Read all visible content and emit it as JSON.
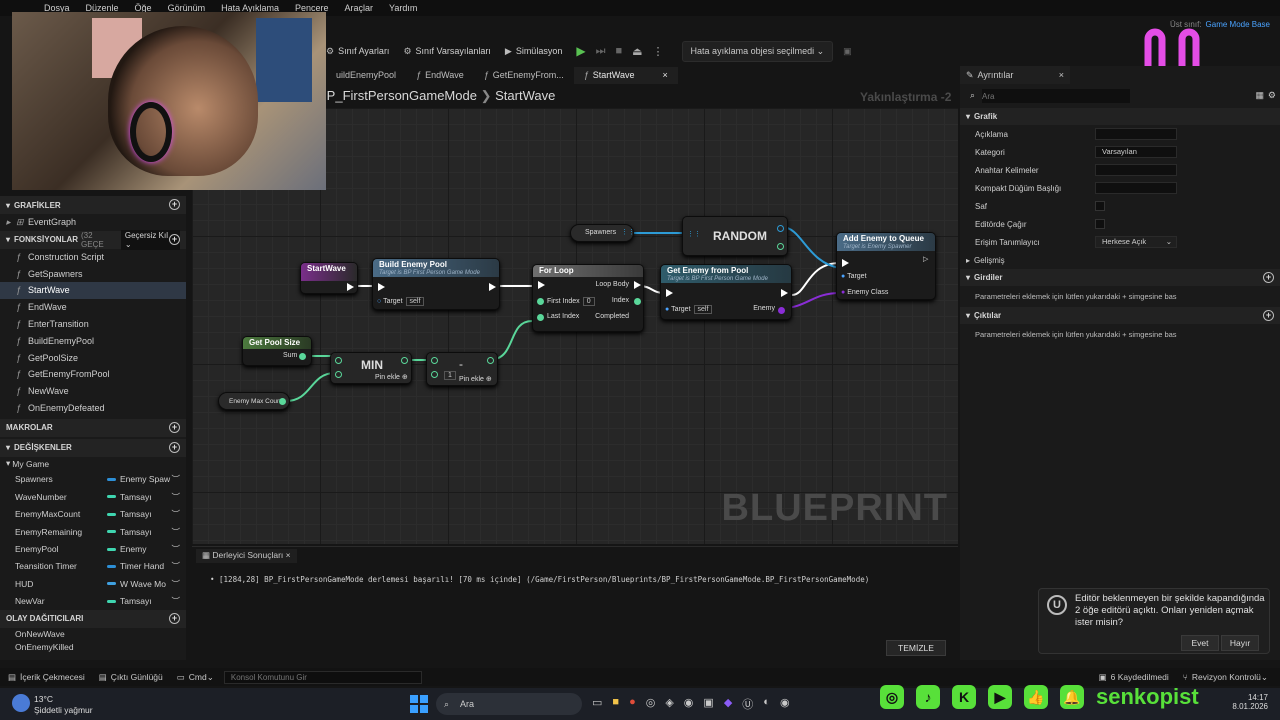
{
  "menu": [
    "Dosya",
    "Düzenle",
    "Öğe",
    "Görünüm",
    "Hata Ayıklama",
    "Pencere",
    "Araçlar",
    "Yardım"
  ],
  "parent_class": {
    "label": "Üst sınıf:",
    "value": "Game Mode Base"
  },
  "toolbar": {
    "class_settings": "Sınıf Ayarları",
    "class_defaults": "Sınıf Varsayılanları",
    "simulation": "Simülasyon",
    "debug_dropdown": "Hata ayıklama objesi seçilmedi"
  },
  "tabs": [
    {
      "label": "uildEnemyPool"
    },
    {
      "label": "EndWave"
    },
    {
      "label": "GetEnemyFrom..."
    },
    {
      "label": "StartWave",
      "active": true
    }
  ],
  "breadcrumb": {
    "graph": "BP_FirstPersonGameMode",
    "function": "StartWave"
  },
  "zoom": "Yakınlaştırma -2",
  "watermark": "BLUEPRINT",
  "nodes": {
    "startwave": "StartWave",
    "build": {
      "title": "Build Enemy Pool",
      "sub": "Target is BP First Person Game Mode",
      "target": "Target",
      "self": "self"
    },
    "forloop": {
      "title": "For Loop",
      "loop_body": "Loop Body",
      "first_index": "First Index",
      "first_val": "0",
      "index": "Index",
      "last_index": "Last Index",
      "completed": "Completed"
    },
    "getenemy": {
      "title": "Get Enemy from Pool",
      "sub": "Target is BP First Person Game Mode",
      "target": "Target",
      "self": "self",
      "enemy": "Enemy"
    },
    "spawners": "Spawners",
    "random": "RANDOM",
    "addqueue": {
      "title": "Add Enemy to Queue",
      "sub": "Target is Enemy Spawner",
      "target": "Target",
      "enemy_class": "Enemy Class"
    },
    "poolsize": {
      "title": "Get Pool Size",
      "sum": "Sum"
    },
    "min": {
      "title": "MIN",
      "add_pin": "Pin ekle"
    },
    "minus": {
      "title": "-",
      "val": "1",
      "add_pin": "Pin ekle"
    },
    "maxcount": "Enemy Max Count"
  },
  "left": {
    "graphs_header": "GRAFİKLER",
    "event_graph": "EventGraph",
    "functions_header": "FONKSİYONLAR",
    "functions_count": "(32 GEÇE",
    "override_dropdown": "Geçersiz Kıl",
    "functions": [
      "Construction Script",
      "GetSpawners",
      "StartWave",
      "EndWave",
      "EnterTransition",
      "BuildEnemyPool",
      "GetPoolSize",
      "GetEnemyFromPool",
      "NewWave",
      "OnEnemyDefeated"
    ],
    "macros_header": "MAKROLAR",
    "variables_header": "DEĞİŞKENLER",
    "my_game": "My Game",
    "variables": [
      {
        "name": "Spawners",
        "type": "Enemy Spaw",
        "color": "#2d8fd6"
      },
      {
        "name": "WaveNumber",
        "type": "Tamsayı",
        "color": "#3fd6b0"
      },
      {
        "name": "EnemyMaxCount",
        "type": "Tamsayı",
        "color": "#3fd6b0"
      },
      {
        "name": "EnemyRemaining",
        "type": "Tamsayı",
        "color": "#3fd6b0"
      },
      {
        "name": "EnemyPool",
        "type": "Enemy",
        "color": "#3fd6b0"
      },
      {
        "name": "Teansition Timer",
        "type": "Timer Hand",
        "color": "#2d8fd6"
      },
      {
        "name": "HUD",
        "type": "W Wave Mo",
        "color": "#3fa0e0"
      },
      {
        "name": "NewVar",
        "type": "Tamsayı",
        "color": "#3fd6b0"
      }
    ],
    "dispatchers_header": "OLAY DAĞITICILARI",
    "dispatchers": [
      "OnNewWave",
      "OnEnemyKilled"
    ]
  },
  "details": {
    "tab": "Ayrıntılar",
    "search_placeholder": "Ara",
    "graphic_header": "Grafik",
    "rows": {
      "description": "Açıklama",
      "category": "Kategori",
      "category_value": "Varsayılan",
      "keywords": "Anahtar Kelimeler",
      "compact_title": "Kompakt Düğüm Başlığı",
      "pure": "Saf",
      "call_in_editor": "Editörde Çağır",
      "access": "Erişim Tanımlayıcı",
      "access_value": "Herkese Açık",
      "advanced": "Gelişmiş"
    },
    "inputs_header": "Girdiler",
    "inputs_hint": "Parametreleri eklemek için lütfen yukarıdaki + simgesine bas",
    "outputs_header": "Çıktılar",
    "outputs_hint": "Parametreleri eklemek için lütfen yukarıdaki + simgesine bas"
  },
  "compiler": {
    "tab": "Derleyici Sonuçları",
    "message": "[1284,28] BP_FirstPersonGameMode derlemesi başarılı! [70 ms içinde] (/Game/FirstPerson/Blueprints/BP_FirstPersonGameMode.BP_FirstPersonGameMode)",
    "clear": "TEMİZLE"
  },
  "toast": {
    "text": "Editör beklenmeyen bir şekilde kapandığında 2 öğe editörü açıktı. Onları yeniden açmak ister misin?",
    "yes": "Evet",
    "no": "Hayır"
  },
  "bottombar": {
    "content_drawer": "İçerik Çekmecesi",
    "output_log": "Çıktı Günlüğü",
    "cmd": "Cmd",
    "console_placeholder": "Konsol Komutunu Gir",
    "saved": "6 Kaydedilmedi",
    "revision": "Revizyon Kontrolü"
  },
  "taskbar": {
    "weather_temp": "13°C",
    "weather_desc": "Şiddetli yağmur",
    "search": "Ara",
    "time": "14:17",
    "date": "8.01.2026"
  },
  "social": {
    "handle": "senkopist"
  }
}
